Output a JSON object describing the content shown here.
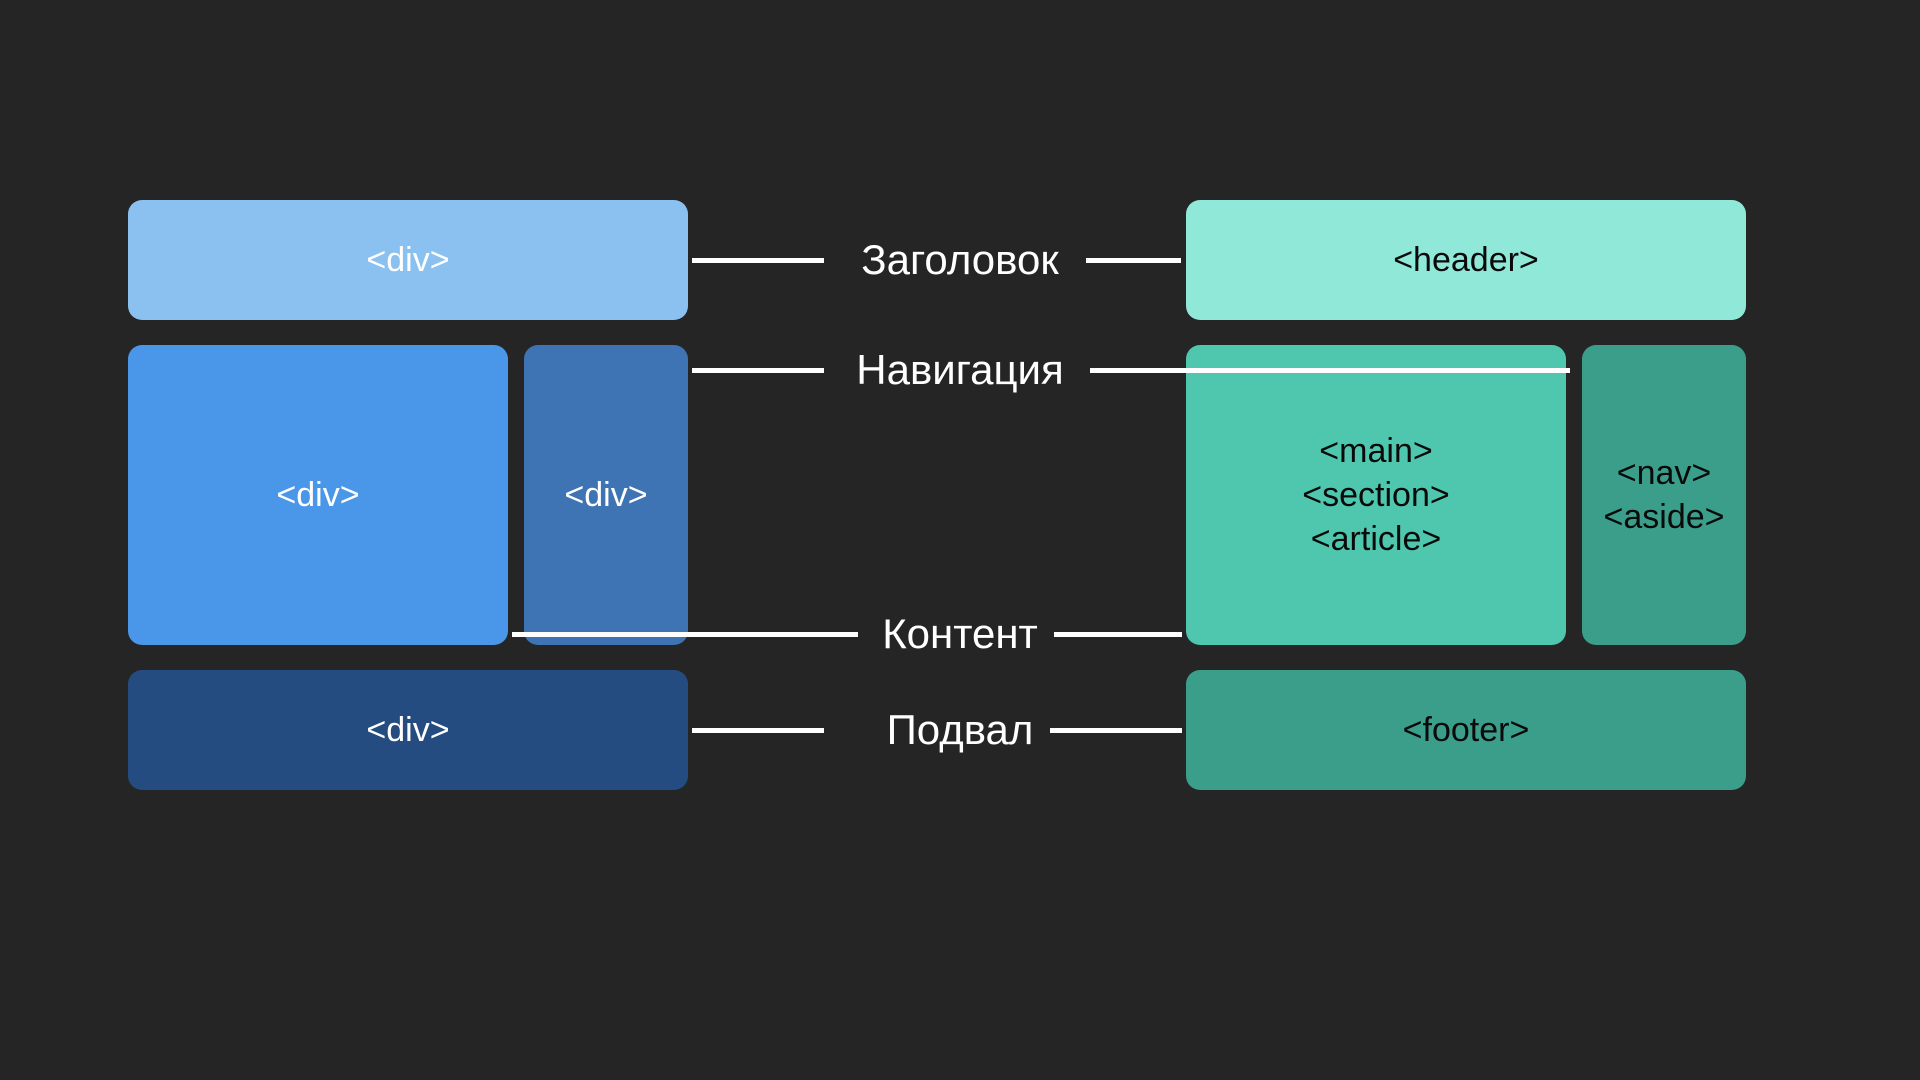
{
  "left": {
    "header": "<div>",
    "main": "<div>",
    "side": "<div>",
    "footer": "<div>"
  },
  "right": {
    "header": "<header>",
    "main_line1": "<main>",
    "main_line2": "<section>",
    "main_line3": "<article>",
    "side_line1": "<nav>",
    "side_line2": "<aside>",
    "footer": "<footer>"
  },
  "labels": {
    "header": "Заголовок",
    "nav": "Навигация",
    "content": "Контент",
    "footer": "Подвал"
  },
  "colors": {
    "background": "#252525",
    "blue_header": "#8ac1f0",
    "blue_main": "#4a96e8",
    "blue_side": "#3e73b4",
    "blue_footer": "#254c80",
    "teal_header": "#90e8d8",
    "teal_main": "#4ec7ae",
    "teal_side": "#3a9e8a",
    "teal_footer": "#3a9e8a"
  }
}
